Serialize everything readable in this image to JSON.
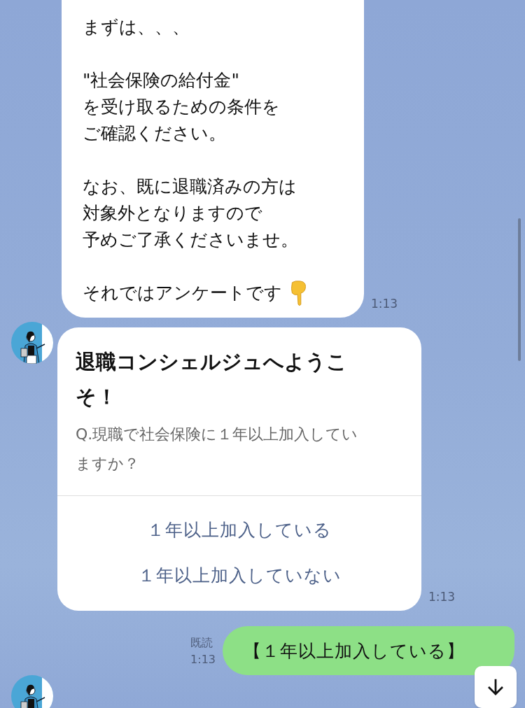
{
  "messages": [
    {
      "kind": "incoming-text",
      "paragraphs": [
        [
          "まずは、、、"
        ],
        [
          "\"社会保険の給付金\"",
          "を受け取るための条件を",
          "ご確認ください。"
        ],
        [
          "なお、既に退職済みの方は",
          "対象外となりますので",
          "予めご了承くださいませ。"
        ],
        [
          "それではアンケートです"
        ]
      ],
      "time": "1:13"
    },
    {
      "kind": "incoming-card",
      "title": "退職コンシェルジュへようこそ！",
      "question": "Q.現職で社会保険に１年以上加入していますか？",
      "options": [
        "１年以上加入している",
        "１年以上加入していない"
      ],
      "time": "1:13"
    },
    {
      "kind": "outgoing-text",
      "text": "【１年以上加入している】",
      "read_label": "既読",
      "time": "1:13"
    },
    {
      "kind": "incoming-avatar-only"
    }
  ]
}
